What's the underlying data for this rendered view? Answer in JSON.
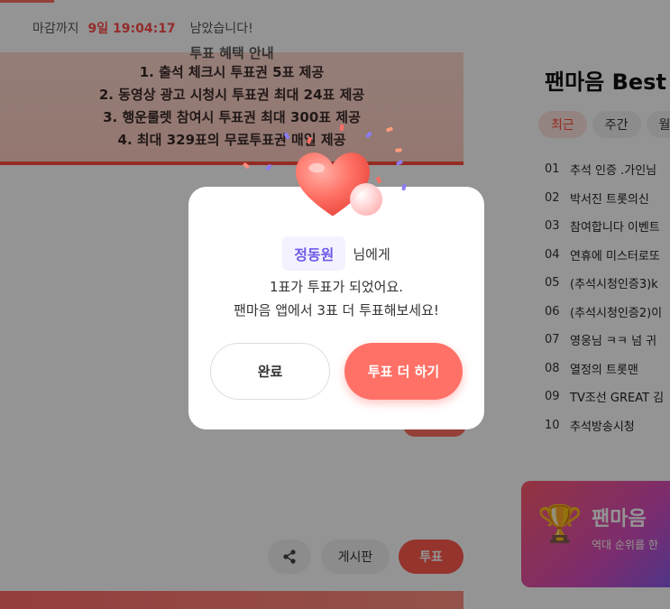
{
  "background": {
    "deadline": {
      "label": "마감까지",
      "time": "9일 19:04:17",
      "suffix": "남았습니다!"
    },
    "benefit": {
      "title": "투표 혜택 안내",
      "items": [
        "1. 출석 체크시 투표권 5표 제공",
        "2. 동영상 광고 시청시 투표권 최대 24표 제공",
        "3. 행운룰렛 참여시 투표권 최대 300표 제공",
        "4. 최대 329표의 무료투표권 매일 제공"
      ]
    },
    "actions": {
      "board_label": "게시판",
      "vote_label": "투표"
    },
    "best": {
      "title": "팬마음 Best",
      "tabs": [
        "최근",
        "주간",
        "월"
      ],
      "items": [
        {
          "num": "01",
          "text": "추석 인증 .가인님"
        },
        {
          "num": "02",
          "text": "박서진 트롯의신"
        },
        {
          "num": "03",
          "text": "참여합니다 이벤트"
        },
        {
          "num": "04",
          "text": "연휴에 미스터로또"
        },
        {
          "num": "05",
          "text": "(추석시청인증3)k"
        },
        {
          "num": "06",
          "text": "(추석시청인증2)이"
        },
        {
          "num": "07",
          "text": "영웅님 ㅋㅋ 넘 귀"
        },
        {
          "num": "08",
          "text": "열정의 트롯맨"
        },
        {
          "num": "09",
          "text": "TV조선 GREAT 김"
        },
        {
          "num": "10",
          "text": "추석방송시청"
        }
      ]
    },
    "promo": {
      "title": "팬마음",
      "subtitle": "역대 순위를 한"
    }
  },
  "modal": {
    "recipient_name": "정동원",
    "recipient_suffix": "님에게",
    "line1": "1표가 투표가 되었어요.",
    "line2": "팬마음 앱에서 3표 더 투표해보세요!",
    "done_label": "완료",
    "more_label": "투표 더 하기"
  },
  "colors": {
    "accent": "#ff7167",
    "name_highlight": "#6c5be6",
    "overlay": "rgba(0,0,0,0.42)"
  }
}
